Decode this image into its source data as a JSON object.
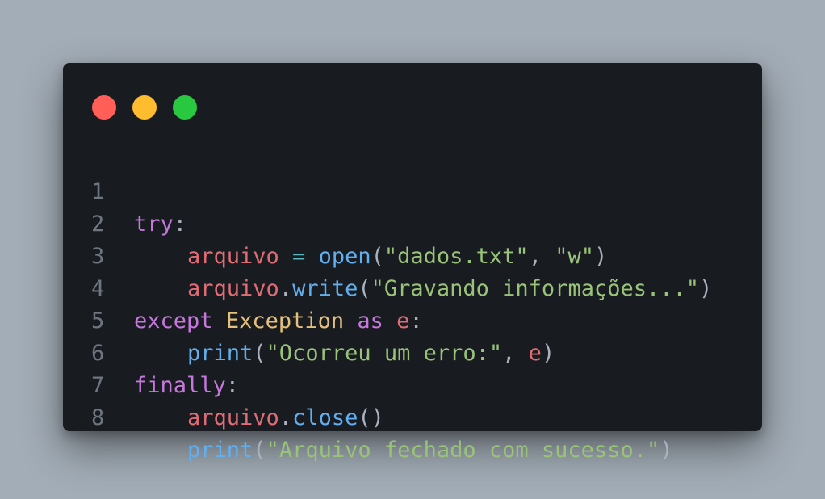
{
  "colors": {
    "background": "#a3adb7",
    "window": "#181b20",
    "dot_red": "#ff5f57",
    "dot_yellow": "#febc2e",
    "dot_green": "#28c840",
    "keyword": "#c678dd",
    "variable": "#e06c75",
    "function": "#61afef",
    "string": "#98c379",
    "class": "#e5c07b",
    "operator": "#56b6c2",
    "punctuation": "#abb2bf",
    "line_number": "#6e7681"
  },
  "window_controls": [
    "close-icon",
    "minimize-icon",
    "maximize-icon"
  ],
  "code": {
    "line_numbers": [
      "1",
      "2",
      "3",
      "4",
      "5",
      "6",
      "7",
      "8"
    ],
    "l1": {
      "kw": "try",
      "p1": ":"
    },
    "l2": {
      "var": "arquivo",
      "op": " = ",
      "fn": "open",
      "p1": "(",
      "s1": "\"dados.txt\"",
      "p2": ", ",
      "s2": "\"w\"",
      "p3": ")"
    },
    "l3": {
      "var": "arquivo",
      "p1": ".",
      "fn": "write",
      "p2": "(",
      "s1": "\"Gravando informações...\"",
      "p3": ")"
    },
    "l4": {
      "kw1": "except",
      "cls": "Exception",
      "kw2": "as",
      "var": "e",
      "p1": ":"
    },
    "l5": {
      "fn": "print",
      "p1": "(",
      "s1": "\"Ocorreu um erro:\"",
      "p2": ", ",
      "var": "e",
      "p3": ")"
    },
    "l6": {
      "kw": "finally",
      "p1": ":"
    },
    "l7": {
      "var": "arquivo",
      "p1": ".",
      "fn": "close",
      "p2": "()"
    },
    "l8": {
      "fn": "print",
      "p1": "(",
      "s1": "\"Arquivo fechado com sucesso.\"",
      "p2": ")"
    }
  }
}
